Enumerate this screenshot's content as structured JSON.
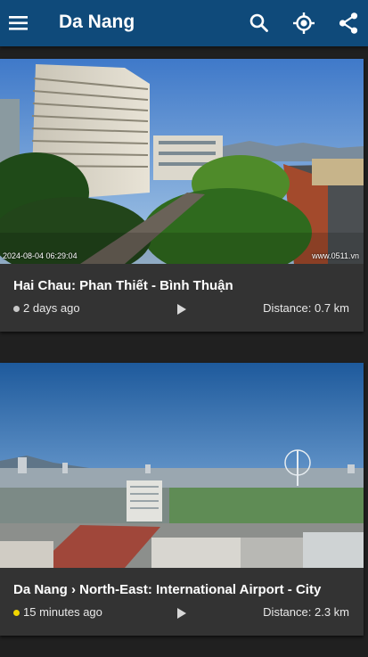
{
  "app": {
    "title": "Da Nang"
  },
  "cameras": [
    {
      "title": "Hai Chau: Phan Thiết - Bình Thuận",
      "age": "2 days ago",
      "status_color": "#c8c8c8",
      "distance": "Distance: 0.7 km",
      "timestamp": "2024-08-04 06:29:04",
      "watermark": "www.0511.vn"
    },
    {
      "title": "Da Nang › North-East: International Airport - City",
      "age": "15 minutes ago",
      "status_color": "#f2d600",
      "distance": "Distance: 2.3 km"
    }
  ],
  "icons": [
    "menu-icon",
    "search-icon",
    "my-location-icon",
    "share-icon",
    "play-icon"
  ]
}
